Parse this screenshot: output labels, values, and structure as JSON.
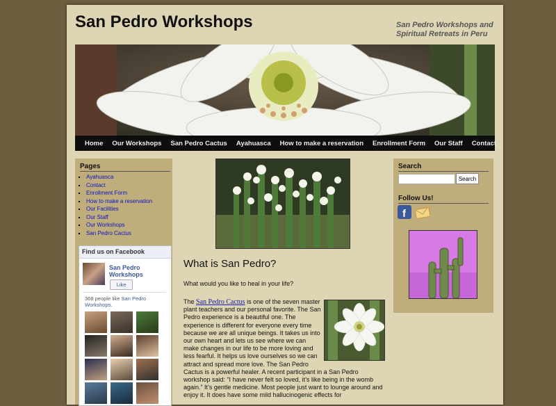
{
  "site": {
    "title": "San Pedro Workshops",
    "tagline": "San Pedro Workshops and Spiritual Retreats in Peru"
  },
  "nav": [
    "Home",
    "Our Workshops",
    "San Pedro Cactus",
    "Ayahuasca",
    "How to make a reservation",
    "Enrollment Form",
    "Our Staff",
    "Contact"
  ],
  "left": {
    "pages_heading": "Pages",
    "pages": [
      "Ayahuasca",
      "Contact",
      "Enrollment Form",
      "How to make a reservation",
      "Our Facilities",
      "Our Staff",
      "Our Workshops",
      "San Pedro Cactus"
    ],
    "facebook": {
      "heading": "Find us on Facebook",
      "page_name": "San Pedro Workshops",
      "like_label": "Like",
      "count_prefix": "368 people like ",
      "count_link": "San Pedro Workshops",
      "count_suffix": "."
    }
  },
  "main": {
    "heading": "What is San Pedro?",
    "question": "What would you like to heal in your life?",
    "intro_before_link": "The ",
    "intro_link": "San Pedro Cactus",
    "body": " is one of the seven master plant teachers and our personal favorite. The San Pedro experience is a beautiful one. The experience is different for everyone every time because we are all unique beings. It takes us into our own heart and lets us see where we can make changes in our life to be more loving and less fearful. It helps us love ourselves so we can attract and spread more love. The San Pedro Cactus is a powerful healer. A recent participant in a San Pedro workshop said: “I have never felt so loved, it’s like being in the womb again.” It’s gentle medicine. Most people just want to lounge around and enjoy it. It does have some mild hallucinogenic effects for"
  },
  "right": {
    "search_heading": "Search",
    "search_button": "Search",
    "search_value": "",
    "follow_heading": "Follow Us!"
  },
  "icons": {
    "facebook": "facebook-icon",
    "mail": "mail-icon"
  },
  "colors": {
    "page_bg": "#ddd5b4",
    "outer_bg": "#6d5e3f",
    "sidebar_bg": "#bfad7c",
    "nav_bg": "#0d0d0d",
    "link": "#0a14c8"
  }
}
